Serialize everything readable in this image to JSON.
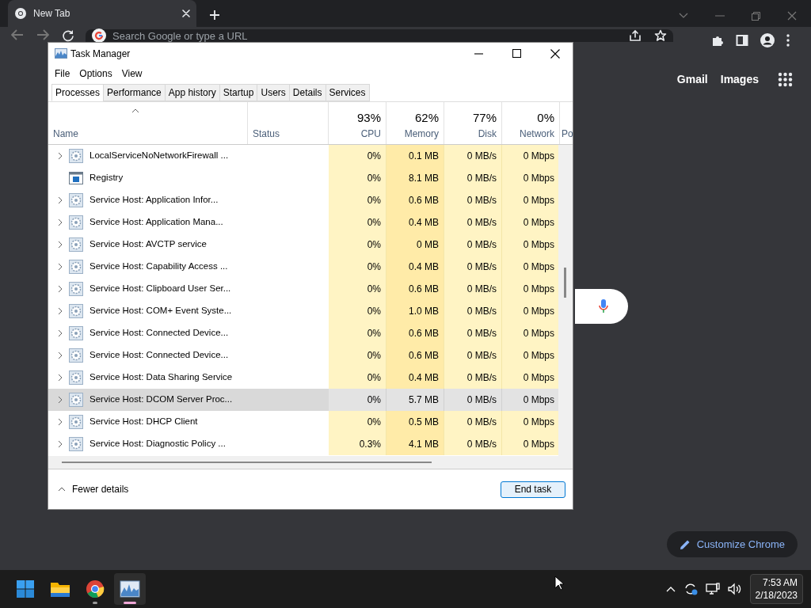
{
  "browser": {
    "tab": {
      "title": "New Tab"
    },
    "omnibox": {
      "placeholder": "Search Google or type a URL"
    },
    "links": [
      "Gmail",
      "Images"
    ],
    "customize_button": "Customize Chrome"
  },
  "task_manager": {
    "title": "Task Manager",
    "menu": [
      "File",
      "Options",
      "View"
    ],
    "tabs": [
      {
        "label": "Processes",
        "selected": true
      },
      {
        "label": "Performance",
        "selected": false
      },
      {
        "label": "App history",
        "selected": false
      },
      {
        "label": "Startup",
        "selected": false
      },
      {
        "label": "Users",
        "selected": false
      },
      {
        "label": "Details",
        "selected": false
      },
      {
        "label": "Services",
        "selected": false
      }
    ],
    "columns": [
      {
        "label": "Name",
        "sorted": true
      },
      {
        "label": "Status",
        "sorted": false
      },
      {
        "label": "CPU",
        "total": "93%",
        "sorted": false
      },
      {
        "label": "Memory",
        "total": "62%",
        "sorted": false
      },
      {
        "label": "Disk",
        "total": "77%",
        "sorted": false
      },
      {
        "label": "Network",
        "total": "0%",
        "sorted": false
      },
      {
        "label": "Po",
        "sorted": false
      }
    ],
    "rows": [
      {
        "name": "LocalServiceNoNetworkFirewall ...",
        "kind": "service",
        "expandable": true,
        "selected": false,
        "cpu": "0%",
        "memory": "0.1 MB",
        "disk": "0 MB/s",
        "network": "0 Mbps"
      },
      {
        "name": "Registry",
        "kind": "app",
        "expandable": false,
        "selected": false,
        "cpu": "0%",
        "memory": "8.1 MB",
        "disk": "0 MB/s",
        "network": "0 Mbps"
      },
      {
        "name": "Service Host: Application Infor...",
        "kind": "service",
        "expandable": true,
        "selected": false,
        "cpu": "0%",
        "memory": "0.6 MB",
        "disk": "0 MB/s",
        "network": "0 Mbps"
      },
      {
        "name": "Service Host: Application Mana...",
        "kind": "service",
        "expandable": true,
        "selected": false,
        "cpu": "0%",
        "memory": "0.4 MB",
        "disk": "0 MB/s",
        "network": "0 Mbps"
      },
      {
        "name": "Service Host: AVCTP service",
        "kind": "service",
        "expandable": true,
        "selected": false,
        "cpu": "0%",
        "memory": "0 MB",
        "disk": "0 MB/s",
        "network": "0 Mbps"
      },
      {
        "name": "Service Host: Capability Access ...",
        "kind": "service",
        "expandable": true,
        "selected": false,
        "cpu": "0%",
        "memory": "0.4 MB",
        "disk": "0 MB/s",
        "network": "0 Mbps"
      },
      {
        "name": "Service Host: Clipboard User Ser...",
        "kind": "service",
        "expandable": true,
        "selected": false,
        "cpu": "0%",
        "memory": "0.6 MB",
        "disk": "0 MB/s",
        "network": "0 Mbps"
      },
      {
        "name": "Service Host: COM+ Event Syste...",
        "kind": "service",
        "expandable": true,
        "selected": false,
        "cpu": "0%",
        "memory": "1.0 MB",
        "disk": "0 MB/s",
        "network": "0 Mbps"
      },
      {
        "name": "Service Host: Connected Device...",
        "kind": "service",
        "expandable": true,
        "selected": false,
        "cpu": "0%",
        "memory": "0.6 MB",
        "disk": "0 MB/s",
        "network": "0 Mbps"
      },
      {
        "name": "Service Host: Connected Device...",
        "kind": "service",
        "expandable": true,
        "selected": false,
        "cpu": "0%",
        "memory": "0.6 MB",
        "disk": "0 MB/s",
        "network": "0 Mbps"
      },
      {
        "name": "Service Host: Data Sharing Service",
        "kind": "service",
        "expandable": true,
        "selected": false,
        "cpu": "0%",
        "memory": "0.4 MB",
        "disk": "0 MB/s",
        "network": "0 Mbps"
      },
      {
        "name": "Service Host: DCOM Server Proc...",
        "kind": "service",
        "expandable": true,
        "selected": true,
        "cpu": "0%",
        "memory": "5.7 MB",
        "disk": "0 MB/s",
        "network": "0 Mbps"
      },
      {
        "name": "Service Host: DHCP Client",
        "kind": "service",
        "expandable": true,
        "selected": false,
        "cpu": "0%",
        "memory": "0.5 MB",
        "disk": "0 MB/s",
        "network": "0 Mbps"
      },
      {
        "name": "Service Host: Diagnostic Policy ...",
        "kind": "service",
        "expandable": true,
        "selected": false,
        "cpu": "0.3%",
        "memory": "4.1 MB",
        "disk": "0 MB/s",
        "network": "0 Mbps"
      }
    ],
    "footer": {
      "toggle": "Fewer details",
      "end_task": "End task"
    }
  },
  "taskbar": {
    "apps": [
      {
        "kind": "start",
        "running": false,
        "active": false
      },
      {
        "kind": "explorer",
        "running": false,
        "active": false
      },
      {
        "kind": "chrome",
        "running": true,
        "active": false
      },
      {
        "kind": "taskmgr",
        "running": true,
        "active": true
      }
    ],
    "clock": {
      "time": "7:53 AM",
      "date": "2/18/2023"
    }
  }
}
